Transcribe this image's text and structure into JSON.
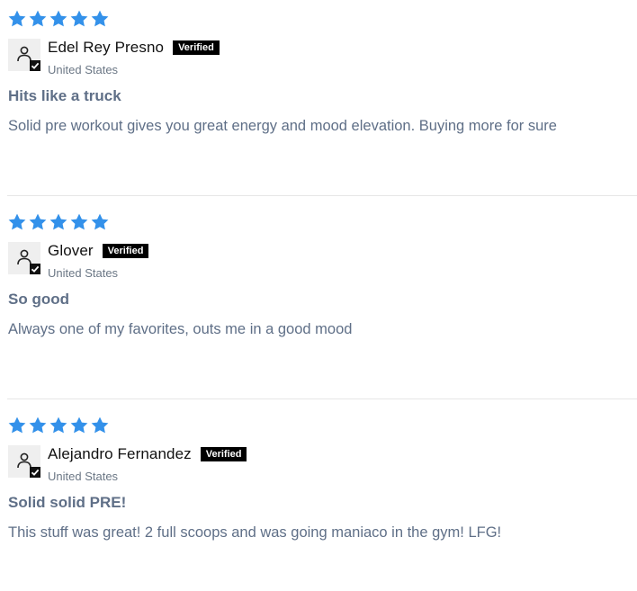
{
  "colors": {
    "star": "#3391ea",
    "text_muted": "#5f6f87",
    "badge_bg": "#000000"
  },
  "reviews": [
    {
      "rating": 5,
      "author": "Edel Rey Presno",
      "badge": "Verified",
      "country": "United States",
      "title": "Hits like a truck",
      "body": "Solid pre workout gives you great energy and mood elevation. Buying more for sure"
    },
    {
      "rating": 5,
      "author": "Glover",
      "badge": "Verified",
      "country": "United States",
      "title": "So good",
      "body": "Always one of my favorites, outs me in a good mood"
    },
    {
      "rating": 5,
      "author": "Alejandro Fernandez",
      "badge": "Verified",
      "country": "United States",
      "title": "Solid solid PRE!",
      "body": "This stuff was great! 2 full scoops and was going maniaco in the gym! LFG!"
    }
  ]
}
